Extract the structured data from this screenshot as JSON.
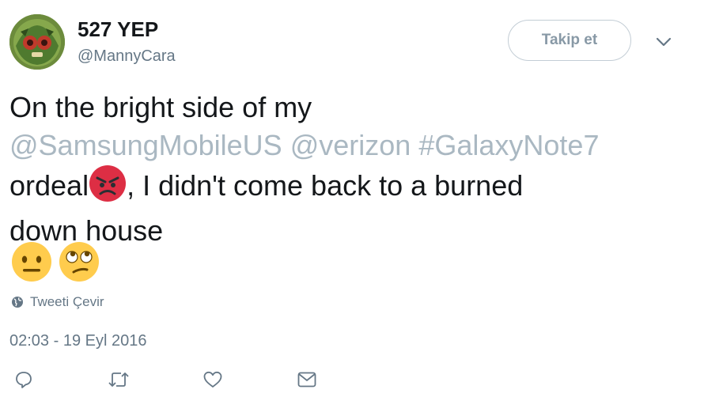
{
  "user": {
    "name": "527 YEP",
    "handle": "@MannyCara"
  },
  "follow_button": "Takip et",
  "tweet": {
    "line1": "On the bright side of my",
    "mention1": "@SamsungMobileUS",
    "mention2": "@verizon",
    "hashtag": "#GalaxyNote7",
    "line3_start": "ordeal",
    "line3_end": ", I didn't come back to a burned",
    "line4": "down house",
    "emojis": [
      "angry-face",
      "neutral-face",
      "eye-roll-face"
    ]
  },
  "translate_label": "Tweeti Çevir",
  "timestamp": "02:03 - 19 Eyl 2016",
  "actions": [
    "reply-icon",
    "retweet-icon",
    "like-icon",
    "message-icon"
  ],
  "colors": {
    "text": "#14171a",
    "secondary": "#657786",
    "mention": "#aab8c2",
    "button_border": "#c3cdd5"
  }
}
